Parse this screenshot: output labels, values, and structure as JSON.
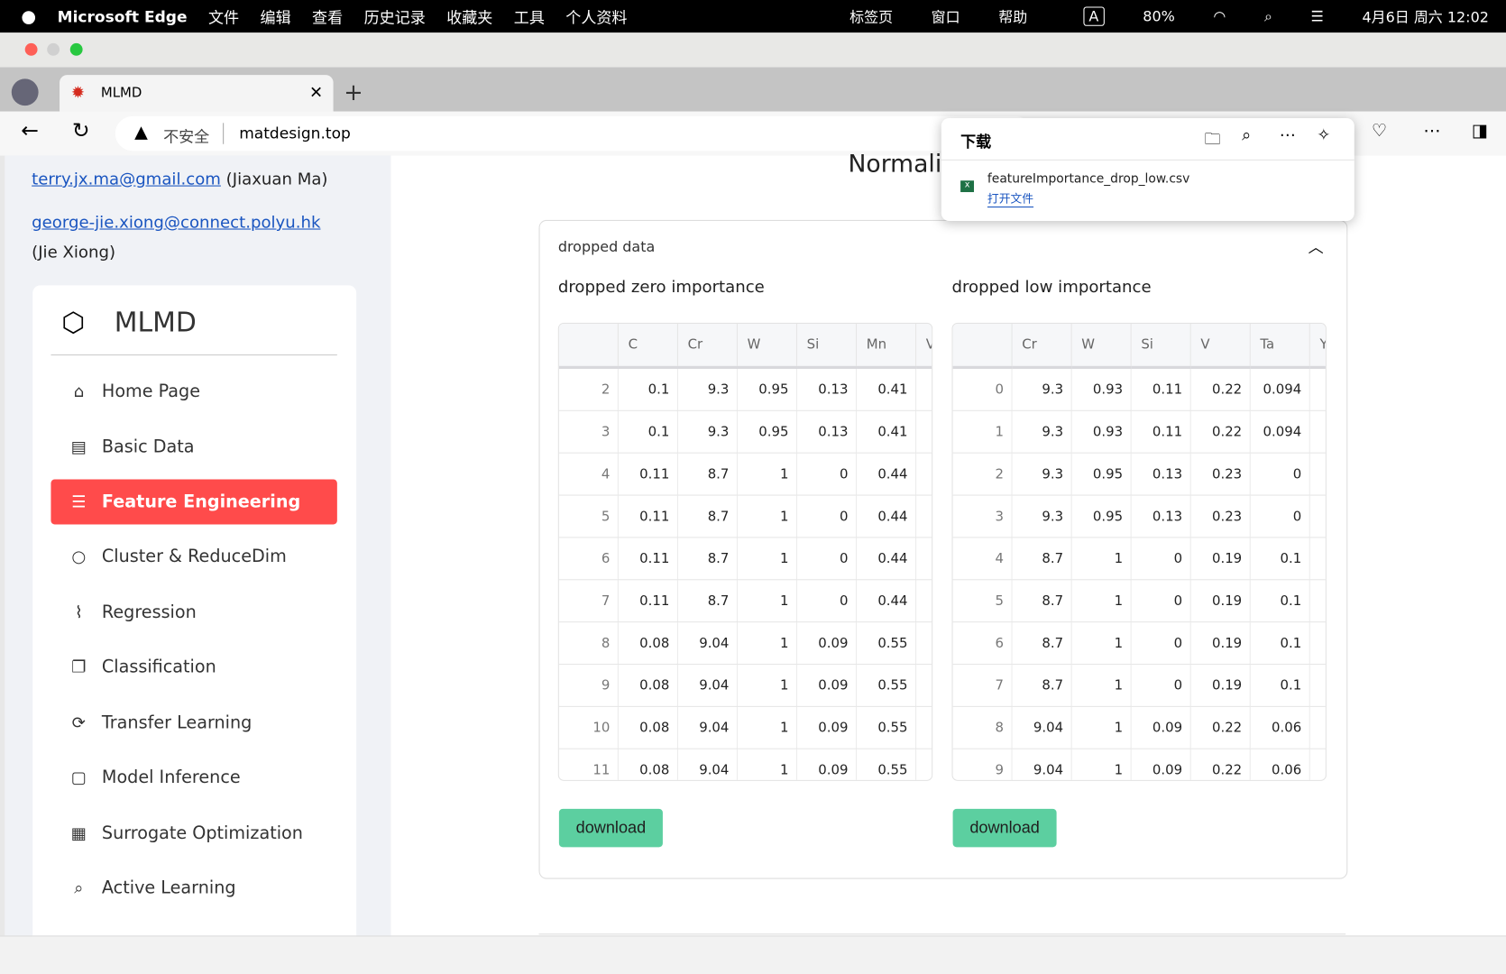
{
  "menubar": {
    "app": "Microsoft Edge",
    "items": [
      "文件",
      "编辑",
      "查看",
      "历史记录",
      "收藏夹",
      "工具",
      "个人资料",
      "标签页",
      "窗口",
      "帮助"
    ],
    "battery": "80%",
    "datetime": "4月6日 周六 12:02",
    "input": "A"
  },
  "tab": {
    "title": "MLMD"
  },
  "address": {
    "security": "不安全",
    "url": "matdesign.top"
  },
  "download_popup": {
    "title": "下载",
    "file": "featureImportance_drop_low.csv",
    "open": "打开文件"
  },
  "sidebar": {
    "contact1": {
      "email": "terry.jx.ma@gmail.com",
      "name": "(Jiaxuan Ma)"
    },
    "contact2": {
      "email": "george-jie.xiong@connect.polyu.hk",
      "name": "(Jie Xiong)"
    },
    "brand": "MLMD",
    "items": [
      {
        "label": "Home Page",
        "icon": "home-icon"
      },
      {
        "label": "Basic Data",
        "icon": "clipboard-chart-icon"
      },
      {
        "label": "Feature Engineering",
        "icon": "list-icon",
        "active": true
      },
      {
        "label": "Cluster & ReduceDim",
        "icon": "circle-icon"
      },
      {
        "label": "Regression",
        "icon": "regression-icon"
      },
      {
        "label": "Classification",
        "icon": "copy-icon"
      },
      {
        "label": "Transfer Learning",
        "icon": "refresh-icon"
      },
      {
        "label": "Model Inference",
        "icon": "square-icon"
      },
      {
        "label": "Surrogate Optimization",
        "icon": "grid-icon"
      },
      {
        "label": "Active Learning",
        "icon": "search-icon"
      }
    ]
  },
  "main": {
    "heading": "Normali",
    "expander_label": "dropped data",
    "accent": "#ff4b4b",
    "left": {
      "title": "dropped zero importance",
      "columns": [
        "",
        "C",
        "Cr",
        "W",
        "Si",
        "Mn",
        "V"
      ],
      "rows": [
        [
          "2",
          "0.1",
          "9.3",
          "0.95",
          "0.13",
          "0.41",
          "("
        ],
        [
          "3",
          "0.1",
          "9.3",
          "0.95",
          "0.13",
          "0.41",
          "("
        ],
        [
          "4",
          "0.11",
          "8.7",
          "1",
          "0",
          "0.44",
          "("
        ],
        [
          "5",
          "0.11",
          "8.7",
          "1",
          "0",
          "0.44",
          "("
        ],
        [
          "6",
          "0.11",
          "8.7",
          "1",
          "0",
          "0.44",
          "("
        ],
        [
          "7",
          "0.11",
          "8.7",
          "1",
          "0",
          "0.44",
          "("
        ],
        [
          "8",
          "0.08",
          "9.04",
          "1",
          "0.09",
          "0.55",
          "("
        ],
        [
          "9",
          "0.08",
          "9.04",
          "1",
          "0.09",
          "0.55",
          "("
        ],
        [
          "10",
          "0.08",
          "9.04",
          "1",
          "0.09",
          "0.55",
          "("
        ],
        [
          "11",
          "0.08",
          "9.04",
          "1",
          "0.09",
          "0.55",
          "("
        ]
      ],
      "download": "download"
    },
    "right": {
      "title": "dropped low importance",
      "columns": [
        "",
        "Cr",
        "W",
        "Si",
        "V",
        "Ta",
        "Y"
      ],
      "rows": [
        [
          "0",
          "9.3",
          "0.93",
          "0.11",
          "0.22",
          "0.094",
          ""
        ],
        [
          "1",
          "9.3",
          "0.93",
          "0.11",
          "0.22",
          "0.094",
          ""
        ],
        [
          "2",
          "9.3",
          "0.95",
          "0.13",
          "0.23",
          "0",
          ""
        ],
        [
          "3",
          "9.3",
          "0.95",
          "0.13",
          "0.23",
          "0",
          ""
        ],
        [
          "4",
          "8.7",
          "1",
          "0",
          "0.19",
          "0.1",
          ""
        ],
        [
          "5",
          "8.7",
          "1",
          "0",
          "0.19",
          "0.1",
          ""
        ],
        [
          "6",
          "8.7",
          "1",
          "0",
          "0.19",
          "0.1",
          ""
        ],
        [
          "7",
          "8.7",
          "1",
          "0",
          "0.19",
          "0.1",
          ""
        ],
        [
          "8",
          "9.04",
          "1",
          "0.09",
          "0.22",
          "0.06",
          ""
        ],
        [
          "9",
          "9.04",
          "1",
          "0.09",
          "0.22",
          "0.06",
          ""
        ]
      ],
      "download": "download"
    }
  }
}
